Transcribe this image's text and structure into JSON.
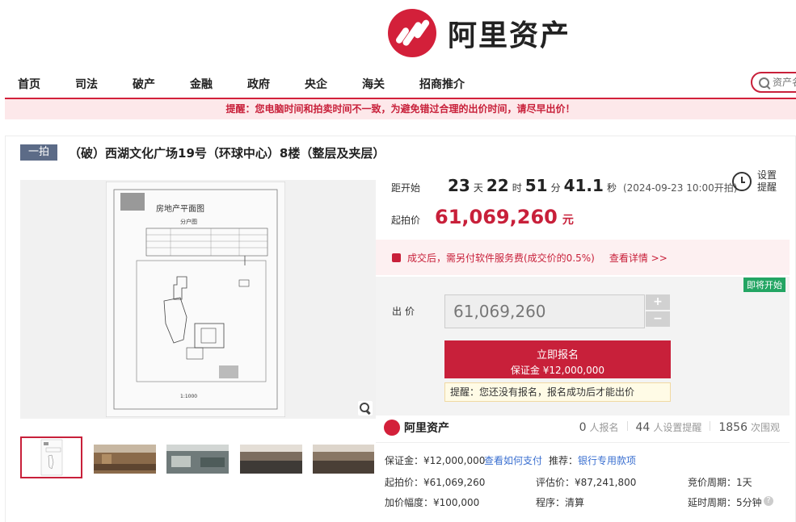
{
  "brand": {
    "name": "阿里资产",
    "color": "#d3203a"
  },
  "nav": [
    "首页",
    "司法",
    "破产",
    "金融",
    "政府",
    "央企",
    "海关",
    "招商推介"
  ],
  "search": {
    "placeholder": "资产名"
  },
  "notice": "提醒：您电脑时间和拍卖时间不一致，为避免错过合理的出价时间，请尽早出价！",
  "item": {
    "badge": "一拍",
    "title": "（破）西湖文化广场19号（环球中心）8楼（整层及夹层）"
  },
  "image": {
    "floorplan_title": "房地产平面图",
    "floorplan_subtitle": "分户图",
    "scale": "1:1000",
    "thumbnails": 5
  },
  "countdown": {
    "label": "距开始",
    "days": "23",
    "days_unit": "天",
    "hours": "22",
    "hours_unit": "时",
    "minutes": "51",
    "minutes_unit": "分",
    "seconds": "41.1",
    "seconds_unit": "秒",
    "start_note": "(2024-09-23 10:00开拍)"
  },
  "reminder": {
    "label": "设置提醒"
  },
  "start_price": {
    "label": "起拍价",
    "value": "61,069,260",
    "unit": "元"
  },
  "fee": {
    "text": "成交后，需另付软件服务费(成交价的0.5%)",
    "link": "查看详情 >>"
  },
  "bid": {
    "soon_badge": "即将开始",
    "label": "出价",
    "value": "61,069,260",
    "plus": "+",
    "minus": "−",
    "signup_label": "立即报名",
    "deposit_line": "保证金 ¥12,000,000",
    "tip": "提醒：您还没有报名，报名成功后才能出价"
  },
  "stats": [
    {
      "num": "0",
      "label": "人报名"
    },
    {
      "num": "44",
      "label": "人设置提醒"
    },
    {
      "num": "1856",
      "label": "次围观"
    }
  ],
  "details": {
    "deposit": "保证金：¥12,000,000",
    "how_to_pay": "查看如何支付",
    "recommend_label": "推荐：",
    "recommend_link": "银行专用款项",
    "start_price": "起拍价：¥61,069,260",
    "eval_price": "评估价：¥87,241,800",
    "cycle": "竞价周期：1天",
    "increment": "加价幅度：¥100,000",
    "procedure": "程序：清算",
    "delay": "延时周期：5分钟"
  },
  "colors": {
    "accent": "#c8203a",
    "badge": "#5c6b87",
    "green": "#23a563",
    "link": "#3a6fd0"
  }
}
